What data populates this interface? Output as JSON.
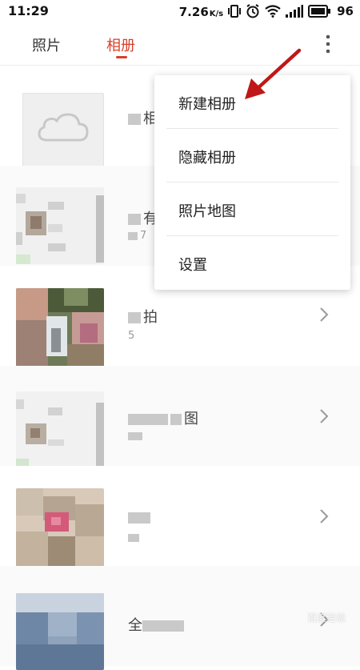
{
  "status_bar": {
    "time": "11:29",
    "network_speed": "7.26",
    "speed_unit": "K/s",
    "battery_level": "96"
  },
  "tabs": [
    {
      "label": "照片",
      "selected": false
    },
    {
      "label": "相册",
      "selected": true
    }
  ],
  "colors": {
    "accent": "#d9402b",
    "annotation_arrow": "#c01818"
  },
  "menu": {
    "items": [
      {
        "label": "新建相册"
      },
      {
        "label": "隐藏相册"
      },
      {
        "label": "照片地图"
      },
      {
        "label": "设置"
      }
    ]
  },
  "albums": [
    {
      "name": "相",
      "count": ""
    },
    {
      "name": "有",
      "count": "7"
    },
    {
      "name": "拍",
      "count": "5"
    },
    {
      "name": "图",
      "count": ""
    },
    {
      "name": "",
      "count": ""
    },
    {
      "name": "全",
      "count": ""
    }
  ],
  "watermark": "百度经验"
}
